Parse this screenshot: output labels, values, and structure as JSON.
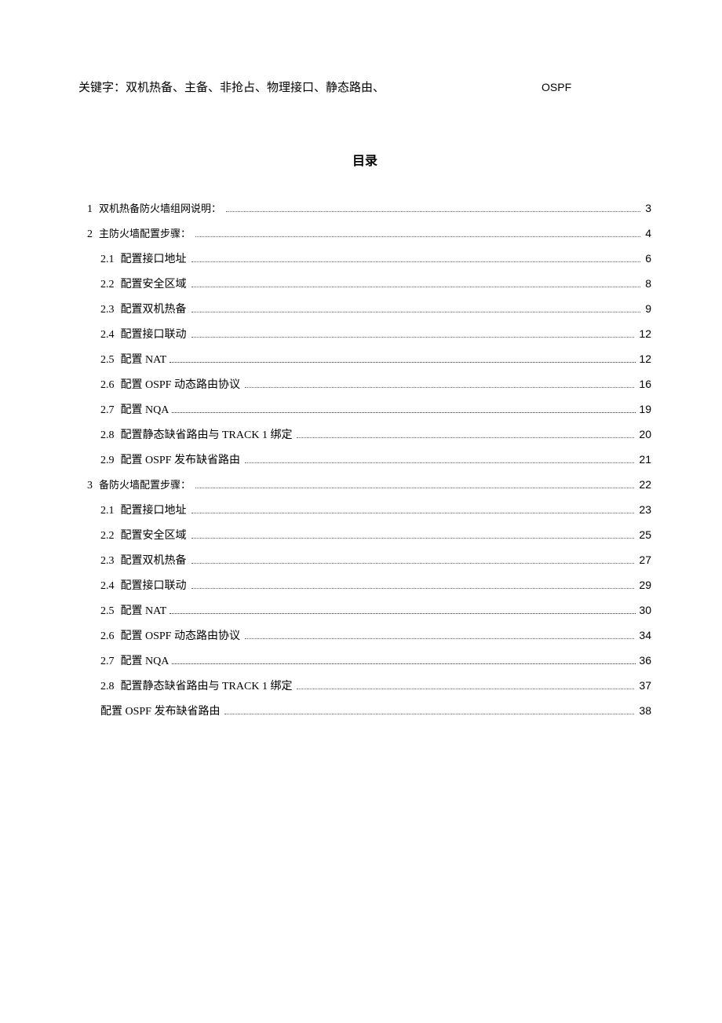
{
  "keywords": {
    "label": "关键字：",
    "content": "双机热备、主备、非抢占、物理接口、静态路由、",
    "trailing": "OSPF"
  },
  "toc": {
    "title": "目录",
    "items": [
      {
        "level": 1,
        "number": "1",
        "text": "双机热备防火墙组网说明：",
        "page": "3",
        "dense": false
      },
      {
        "level": 1,
        "number": "2",
        "text": "主防火墙配置步骤：",
        "page": "4",
        "dense": false
      },
      {
        "level": 2,
        "number": "2.1",
        "text": "配置接口地址",
        "page": "6",
        "dense": false
      },
      {
        "level": 2,
        "number": "2.2",
        "text": "配置安全区域",
        "page": "8",
        "dense": false
      },
      {
        "level": 2,
        "number": "2.3",
        "text": "配置双机热备",
        "page": "9",
        "dense": false
      },
      {
        "level": 2,
        "number": "2.4",
        "text": "配置接口联动",
        "page": "12",
        "dense": false
      },
      {
        "level": 2,
        "number": "2.5",
        "text": "配置  NAT",
        "page": "12",
        "dense": true
      },
      {
        "level": 2,
        "number": "2.6",
        "text": "配置  OSPF 动态路由协议",
        "page": "16",
        "dense": false
      },
      {
        "level": 2,
        "number": "2.7",
        "text": "配置  NQA",
        "page": "19",
        "dense": true
      },
      {
        "level": 2,
        "number": "2.8",
        "text": "配置静态缺省路由与  TRACK 1 绑定",
        "page": "20",
        "dense": false
      },
      {
        "level": 2,
        "number": "2.9",
        "text": "配置  OSPF 发布缺省路由",
        "page": "21",
        "dense": false
      },
      {
        "level": 1,
        "number": "3",
        "text": "备防火墙配置步骤：",
        "page": "22",
        "dense": false
      },
      {
        "level": 2,
        "number": "2.1",
        "text": "配置接口地址",
        "page": "23",
        "dense": false
      },
      {
        "level": 2,
        "number": "2.2",
        "text": "配置安全区域",
        "page": "25",
        "dense": false
      },
      {
        "level": 2,
        "number": "2.3",
        "text": "配置双机热备",
        "page": "27",
        "dense": false
      },
      {
        "level": 2,
        "number": "2.4",
        "text": "配置接口联动",
        "page": "29",
        "dense": false
      },
      {
        "level": 2,
        "number": "2.5",
        "text": "配置  NAT",
        "page": "30",
        "dense": true
      },
      {
        "level": 2,
        "number": "2.6",
        "text": "配置  OSPF 动态路由协议",
        "page": "34",
        "dense": false
      },
      {
        "level": 2,
        "number": "2.7",
        "text": "配置  NQA",
        "page": "36",
        "dense": true
      },
      {
        "level": 2,
        "number": "2.8",
        "text": "配置静态缺省路由与  TRACK 1 绑定",
        "page": "37",
        "dense": false
      },
      {
        "level": 2,
        "number": "",
        "text": "配置  OSPF 发布缺省路由",
        "page": "38",
        "dense": false
      }
    ]
  }
}
